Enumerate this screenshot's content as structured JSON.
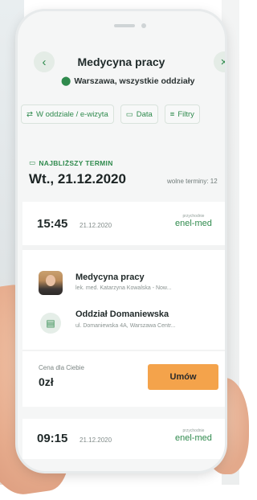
{
  "header": {
    "title": "Medycyna pracy",
    "location": "Warszawa, wszystkie oddziały",
    "back_icon": "‹",
    "close_icon": "×"
  },
  "filters": [
    {
      "label": "W oddziale / e-wizyta",
      "icon": "visit-type-icon"
    },
    {
      "label": "Data",
      "icon": "calendar-icon"
    },
    {
      "label": "Filtry",
      "icon": "filter-icon"
    }
  ],
  "nearest": {
    "label": "NAJBLIŻSZY TERMIN",
    "date": "Wt., 21.12.2020",
    "free_slots": "wolne terminy: 12"
  },
  "slots": [
    {
      "time": "15:45",
      "date": "21.12.2020",
      "brand_small": "przychodnie",
      "brand": "enel-med",
      "doctor_title": "Medycyna pracy",
      "doctor_name": "lek. med. Katarzyna Kowalska - Now...",
      "branch_title": "Oddział Domaniewska",
      "branch_address": "ul. Domaniewska 4A, Warszawa Centr...",
      "price_label": "Cena dla Ciebie",
      "price": "0zł",
      "button": "Umów"
    },
    {
      "time": "09:15",
      "date": "21.12.2020",
      "brand_small": "przychodnie",
      "brand": "enel-med"
    }
  ],
  "colors": {
    "accent_green": "#2f8a4d",
    "button_orange": "#f4a34b"
  }
}
